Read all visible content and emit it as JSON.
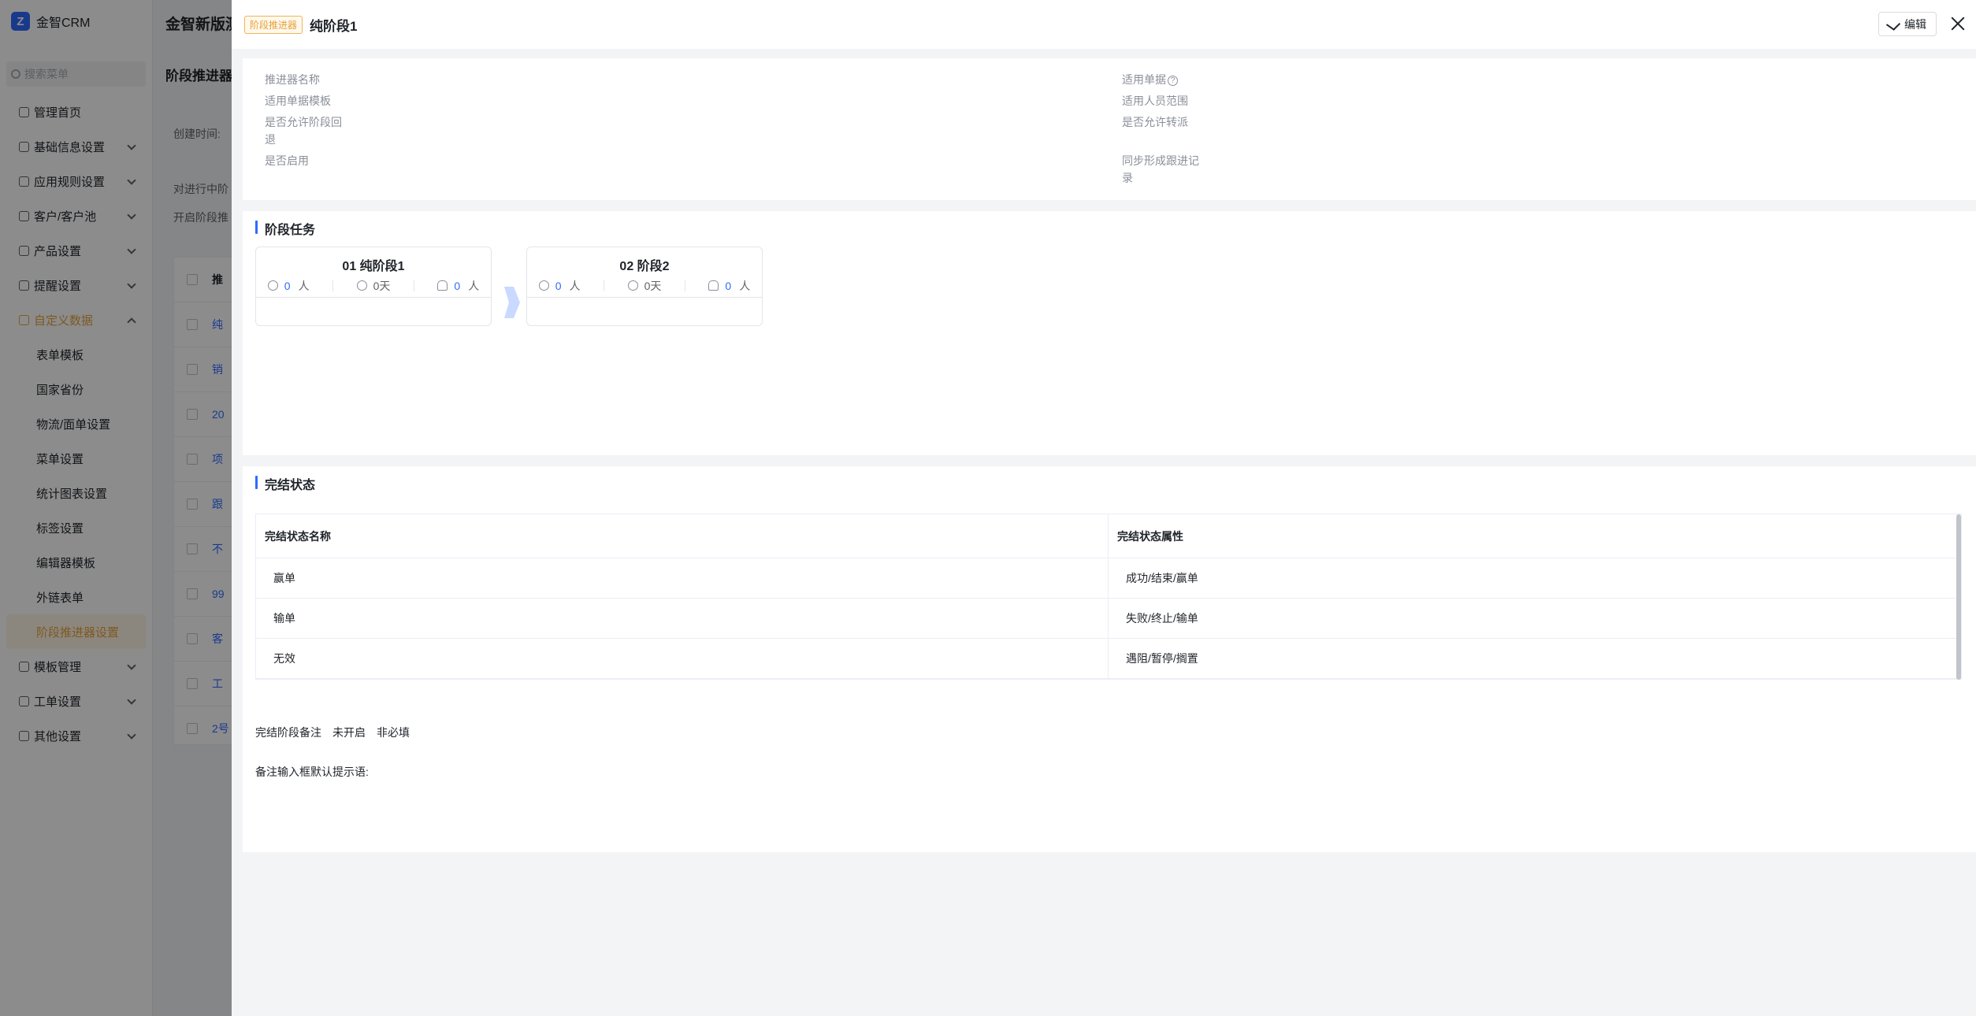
{
  "app": {
    "logo_text": "金智CRM",
    "header_title": "金智新版测",
    "search_placeholder": "搜索菜单",
    "menu": [
      {
        "label": "管理首页"
      },
      {
        "label": "基础信息设置"
      },
      {
        "label": "应用规则设置"
      },
      {
        "label": "客户/客户池"
      },
      {
        "label": "产品设置"
      },
      {
        "label": "提醒设置"
      },
      {
        "label": "自定义数据"
      }
    ],
    "submenu": [
      {
        "label": "表单模板"
      },
      {
        "label": "国家省份"
      },
      {
        "label": "物流/面单设置"
      },
      {
        "label": "菜单设置"
      },
      {
        "label": "统计图表设置"
      },
      {
        "label": "标签设置"
      },
      {
        "label": "编辑器模板"
      },
      {
        "label": "外链表单"
      },
      {
        "label": "阶段推进器设置"
      }
    ],
    "menu_bottom": [
      {
        "label": "模板管理"
      },
      {
        "label": "工单设置"
      },
      {
        "label": "其他设置"
      }
    ],
    "page_title": "阶段推进器",
    "filter_label": "创建时间:",
    "tip1": "对进行中阶",
    "tip2": "开启阶段推",
    "table_header": "推",
    "table_rows": [
      "纯",
      "销",
      "20",
      "项",
      "跟",
      "不",
      "99",
      "客",
      "工",
      "2号"
    ]
  },
  "drawer": {
    "tag": "阶段推进器",
    "title": "纯阶段1",
    "edit_label": "编辑",
    "info": {
      "left": [
        "推进器名称",
        "适用单据模板",
        "是否允许阶段回退",
        "是否启用"
      ],
      "right_0": "适用单据",
      "right_0_help": "?",
      "right": [
        "适用人员范围",
        "是否允许转派",
        "同步形成跟进记录"
      ]
    },
    "tasks": {
      "title": "阶段任务",
      "stages": [
        {
          "name": "01 纯阶段1",
          "people": "0",
          "people_unit": "人",
          "days": "0天",
          "reminders": "0",
          "reminders_unit": "人"
        },
        {
          "name": "02 阶段2",
          "people": "0",
          "people_unit": "人",
          "days": "0天",
          "reminders": "0",
          "reminders_unit": "人"
        }
      ]
    },
    "status": {
      "title": "完结状态",
      "columns": [
        "完结状态名称",
        "完结状态属性"
      ],
      "rows": [
        {
          "name": "赢单",
          "attr": "成功/结束/赢单"
        },
        {
          "name": "输单",
          "attr": "失败/终止/输单"
        },
        {
          "name": "无效",
          "attr": "遇阻/暂停/搁置"
        }
      ],
      "remark_label": "完结阶段备注",
      "remark_enabled": "未开启",
      "remark_required": "非必填",
      "remark_hint_label": "备注输入框默认提示语:"
    }
  },
  "colors": {
    "accent": "#2f6bff",
    "tag": "#e6a23c",
    "overlay": "rgba(0,0,0,0.45)"
  }
}
